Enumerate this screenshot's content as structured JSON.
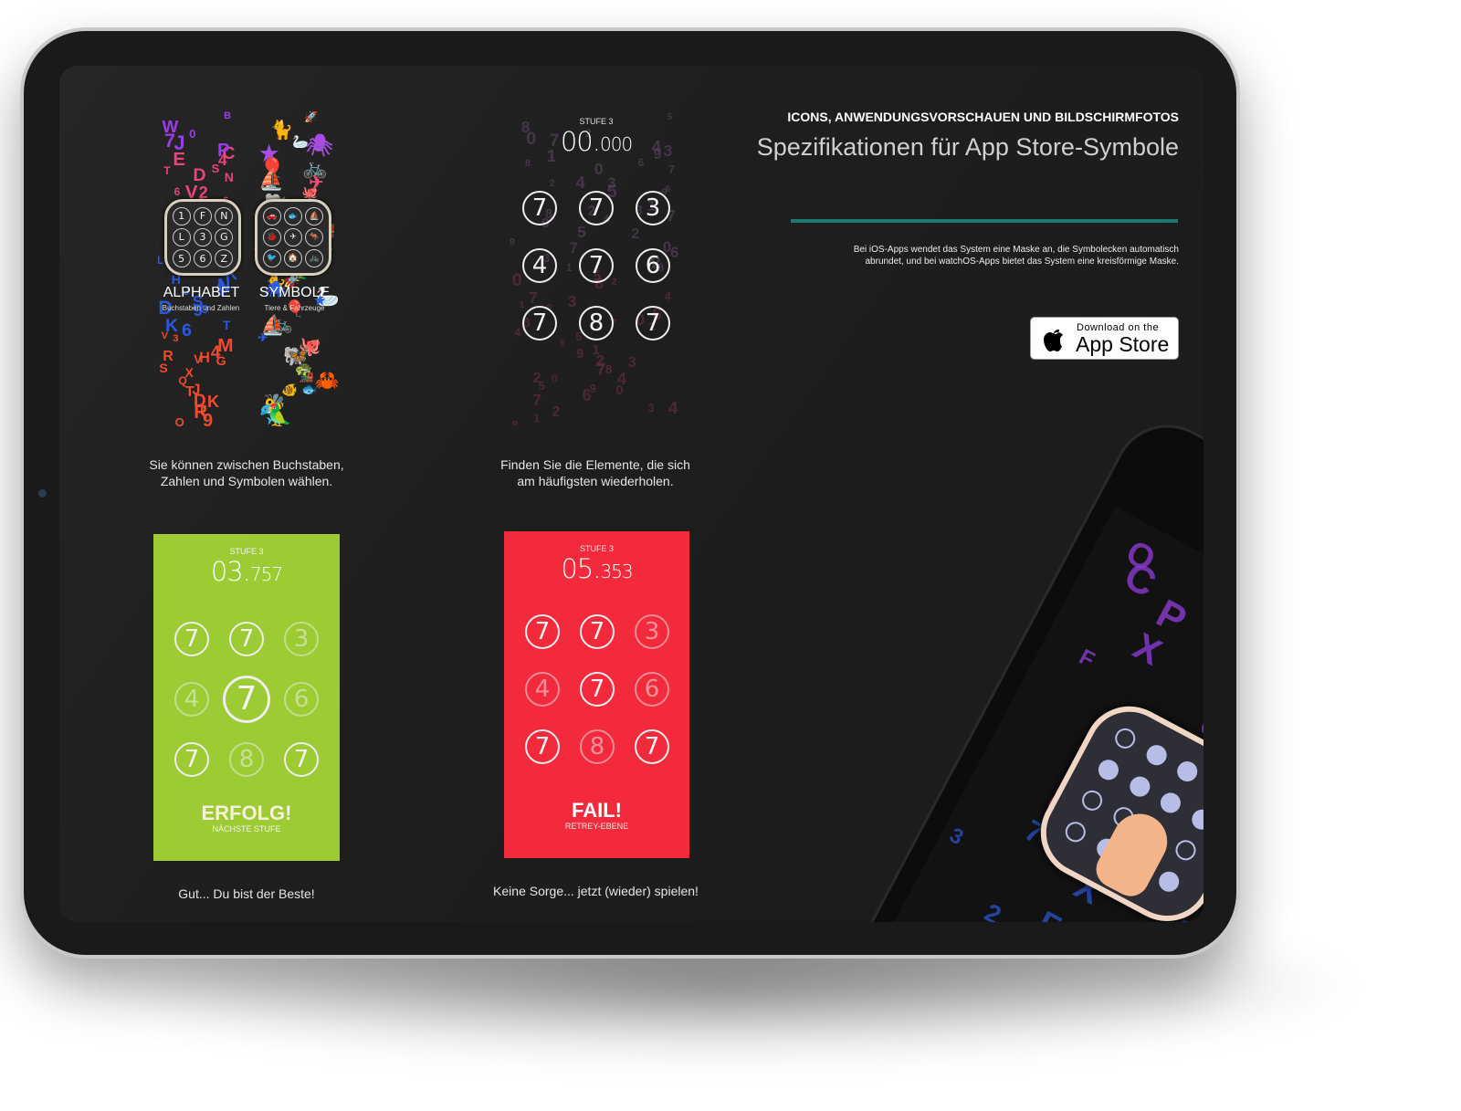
{
  "header": {
    "kicker": "ICONS, ANWENDUNGSVORSCHAUEN UND BILDSCHIRMFOTOS",
    "title": "Spezifikationen für App Store-Symbole",
    "description_line1": "Bei iOS-Apps wendet das System eine Maske an, die Symbolecken automatisch",
    "description_line2": "abrundet, und bei watchOS-Apps bietet das System eine kreisförmige Maske.",
    "accent_color": "#1e7a70"
  },
  "badge": {
    "small": "Download on the",
    "large": "App Store",
    "icon": "apple-icon"
  },
  "panel1": {
    "alphabet_title": "ALPHABET",
    "alphabet_sub": "Buchstaben und Zahlen",
    "symbole_title": "SYMBOLE",
    "symbole_sub": "Tiere & Fahrzeuge",
    "alphabet_keys": [
      "1",
      "F",
      "N",
      "L",
      "3",
      "G",
      "5",
      "6",
      "Z"
    ],
    "symbol_keys": [
      "🚗",
      "🐟",
      "⛵",
      "🐞",
      "✈",
      "🦘",
      "🐦",
      "🏠",
      "🚲"
    ],
    "decor_letters": "BW70JCPE4SDTN26VL6PFX40S5E4QLGK8HANUPS9DOK6TV3M4RHVGSXQTJKDTR9O",
    "decor_symbols": "🚀🐈🕷🦢★🎈🚲⛵✈🐙🐘🦋🐢🚂🦀🐟🐠🐝🐬🦜",
    "caption_line1": "Sie können zwischen Buchstaben,",
    "caption_line2": "Zahlen und Symbolen wählen."
  },
  "panel2": {
    "level": "STUFE 3",
    "time_main": "00.",
    "time_ms": "000",
    "keys": [
      "7",
      "7",
      "3",
      "4",
      "7",
      "6",
      "7",
      "8",
      "7"
    ],
    "decor_letters": "5802734196087324569132874025906734218",
    "caption_line1": "Finden Sie die Elemente, die sich",
    "caption_line2": "am häufigsten wiederholen."
  },
  "success_card": {
    "level": "STUFE 3",
    "time_main": "03.",
    "time_ms": "757",
    "keys": [
      "7",
      "7",
      "3",
      "4",
      "7",
      "6",
      "7",
      "8",
      "7"
    ],
    "highlighted": [
      true,
      true,
      false,
      false,
      true,
      false,
      true,
      false,
      true
    ],
    "result": "ERFOLG!",
    "sub": "NÄCHSTE STUFE",
    "color": "#9ccb33",
    "caption": "Gut... Du bist der Beste!"
  },
  "fail_card": {
    "level": "STUFE 3",
    "time_main": "05.",
    "time_ms": "353",
    "keys": [
      "7",
      "7",
      "3",
      "4",
      "7",
      "6",
      "7",
      "8",
      "7"
    ],
    "highlighted": [
      true,
      true,
      false,
      false,
      true,
      false,
      true,
      false,
      true
    ],
    "result": "FAIL!",
    "sub": "RETREY-EBENE",
    "color": "#f22a3c",
    "caption": "Keine Sorge... jetzt (wieder) spielen!"
  },
  "phone": {
    "decor_letters": "BOCEP72X3BUF2Q6KSNCA"
  }
}
